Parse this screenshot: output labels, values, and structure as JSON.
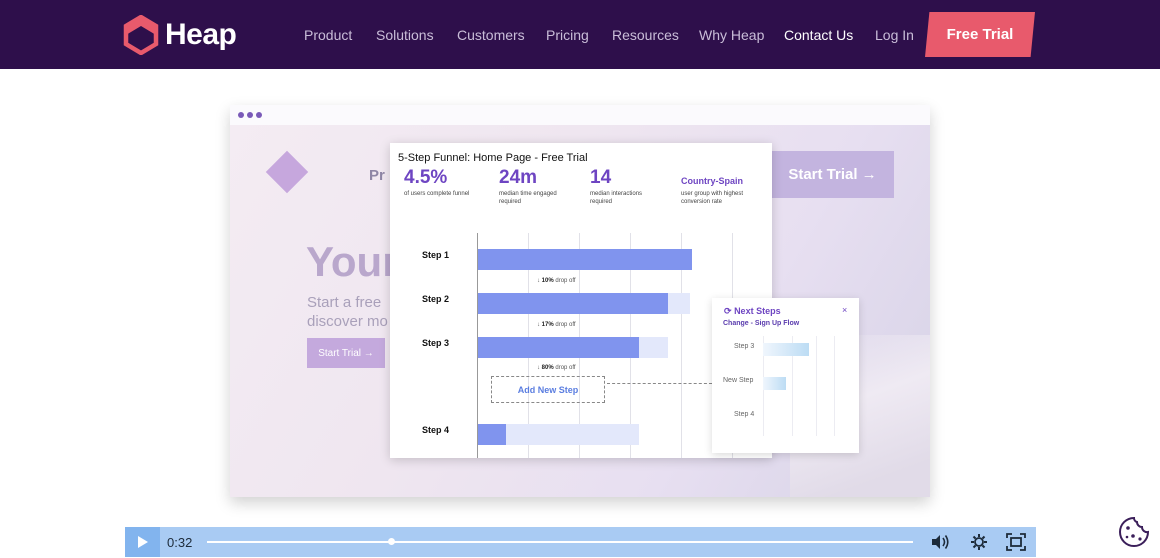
{
  "nav": {
    "brand": "Heap",
    "links": [
      "Product",
      "Solutions",
      "Customers",
      "Pricing",
      "Resources",
      "Why Heap",
      "Contact Us",
      "Log In"
    ],
    "cta": "Free Trial",
    "colors": {
      "background": "#2e0f4b",
      "cta": "#e85a6c",
      "logo": "#e85a6c"
    }
  },
  "video": {
    "background_page": {
      "partial_heading": "Your",
      "partial_text_fragment": "Pr",
      "partial_subtext_line1": "Start a free",
      "partial_subtext_line2": "discover mo",
      "small_button": "Start Trial →",
      "large_button": "Start Trial →"
    },
    "funnel": {
      "title": "5-Step Funnel: Home Page - Free Trial",
      "stats": [
        {
          "value": "4.5%",
          "desc": "of users complete funnel"
        },
        {
          "value": "24m",
          "desc": "median time engaged required"
        },
        {
          "value": "14",
          "desc": "median interactions required"
        }
      ],
      "country": {
        "value": "Country-Spain",
        "desc": "user group with highest conversion rate"
      },
      "steps": [
        {
          "label": "Step 1",
          "fraction": 1.0,
          "bg_fraction": 1.0
        },
        {
          "label": "Step 2",
          "fraction": 0.89,
          "bg_fraction": 0.99
        },
        {
          "label": "Step 3",
          "fraction": 0.75,
          "bg_fraction": 0.89
        },
        {
          "label": "Step 4",
          "fraction": 0.13,
          "bg_fraction": 0.75
        }
      ],
      "drops": [
        {
          "pct": "10%",
          "text": "drop off"
        },
        {
          "pct": "17%",
          "text": "drop off"
        },
        {
          "pct": "80%",
          "text": "drop off"
        }
      ],
      "add_step_label": "Add New Step"
    },
    "next_steps": {
      "title": "Next Steps",
      "subtitle": "Change - Sign Up Flow",
      "close": "×",
      "rows": [
        {
          "label": "Step 3",
          "fraction": 0.65
        },
        {
          "label": "New Step",
          "fraction": 0.32
        },
        {
          "label": "Step 4",
          "fraction": 0
        }
      ]
    }
  },
  "player": {
    "current_time": "0:32",
    "progress_fraction": 0.26,
    "icons": [
      "play-icon",
      "volume-icon",
      "settings-icon",
      "fullscreen-icon"
    ],
    "color": "#a9cbf3"
  },
  "cookie_icon": "cookie-icon"
}
